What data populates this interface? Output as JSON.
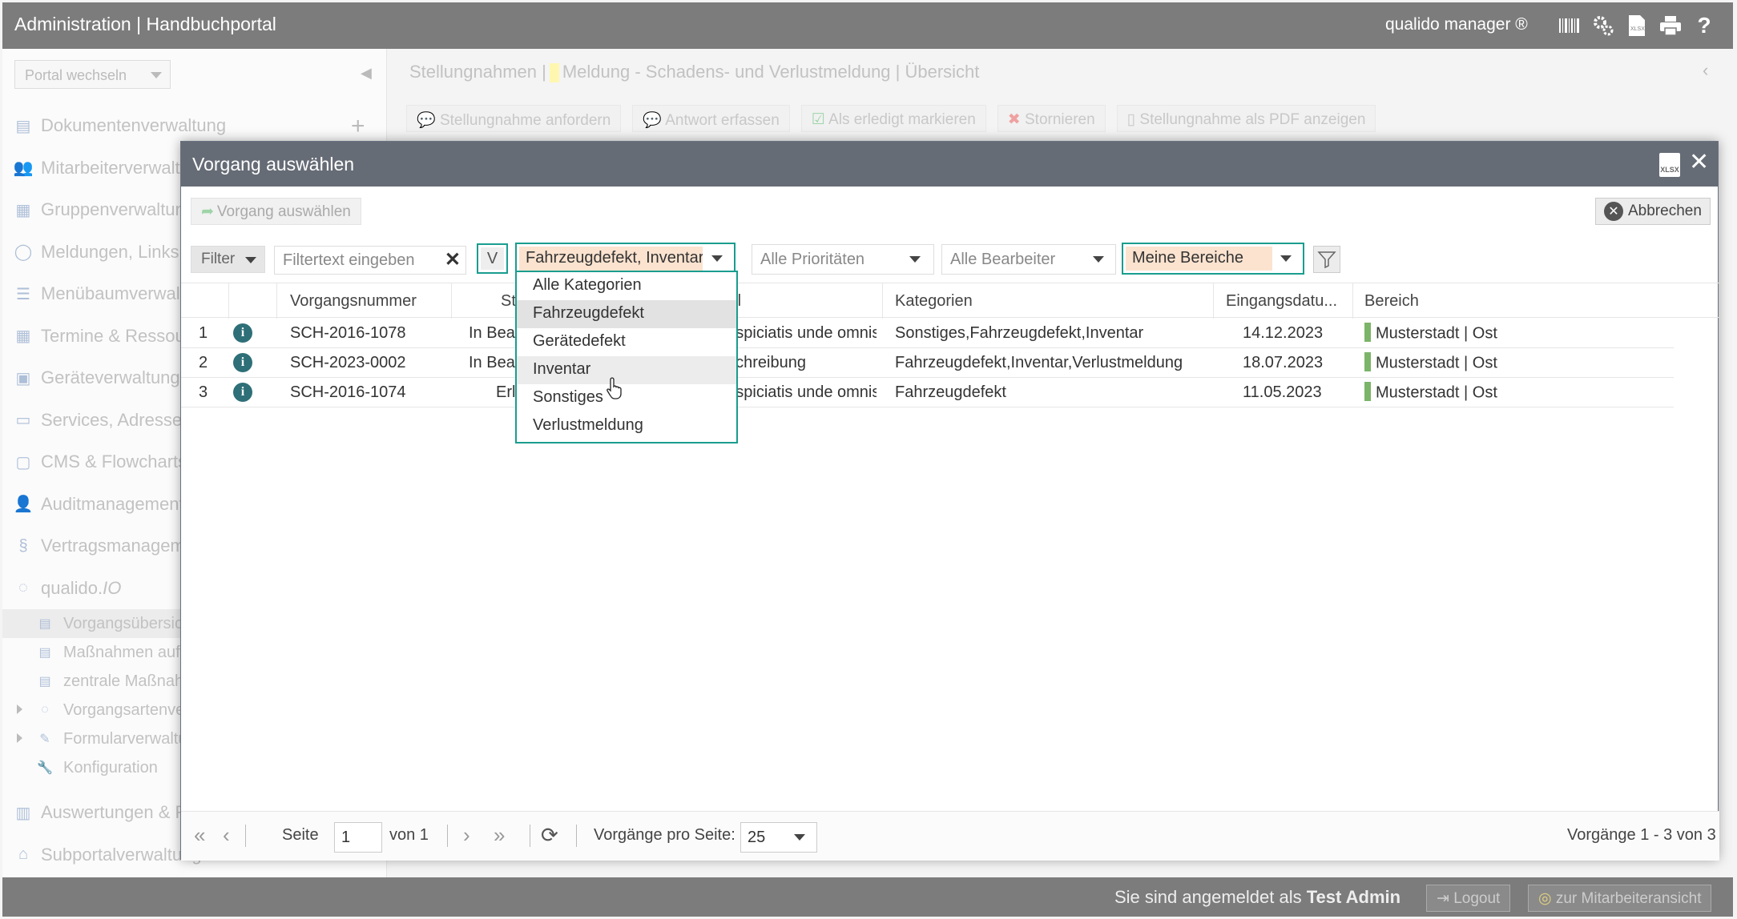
{
  "topbar": {
    "title": "Administration | Handbuchportal",
    "brand": "qualido manager ®",
    "icons": [
      "barcode-icon",
      "gears-icon",
      "xlsx-icon",
      "print-icon",
      "help-icon"
    ]
  },
  "sidebar": {
    "portal_select": "Portal wechseln",
    "items": [
      {
        "label": "Dokumentenverwaltung"
      },
      {
        "label": "Mitarbeiterverwaltung"
      },
      {
        "label": "Gruppenverwaltung"
      },
      {
        "label": "Meldungen, Links"
      },
      {
        "label": "Menübaumverwaltung"
      },
      {
        "label": "Termine & Ressourcen"
      },
      {
        "label": "Geräteverwaltung"
      },
      {
        "label": "Services, Adressen"
      },
      {
        "label": "CMS & Flowcharts"
      },
      {
        "label": "Auditmanagement"
      },
      {
        "label": "Vertragsmanagement"
      },
      {
        "label": "qualido.",
        "label_suffix": "IO"
      }
    ],
    "subitems": [
      {
        "label": "Vorgangsübersicht"
      },
      {
        "label": "Maßnahmen auf"
      },
      {
        "label": "zentrale Maßnahmen"
      },
      {
        "label": "Vorgangsartenverwaltung"
      },
      {
        "label": "Formularverwaltung"
      },
      {
        "label": "Konfiguration"
      }
    ],
    "bottom_items": [
      {
        "label": "Auswertungen & Reports"
      },
      {
        "label": "Subportalverwaltung"
      }
    ]
  },
  "main": {
    "breadcrumb_a": "Stellungnahmen |",
    "breadcrumb_b": "Meldung - Schadens- und Verlustmeldung | Übersicht",
    "toolbar": [
      "Stellungnahme anfordern",
      "Antwort erfassen",
      "Als erledigt markieren",
      "Stornieren",
      "Stellungnahme als PDF anzeigen"
    ]
  },
  "status": {
    "logged_prefix": "Sie sind angemeldet als",
    "user": "Test Admin",
    "logout": "Logout",
    "employee_view": "zur Mitarbeiteransicht"
  },
  "modal": {
    "title": "Vorgang auswählen",
    "select_button": "Vorgang auswählen",
    "cancel_button": "Abbrechen",
    "filter_label": "Filter",
    "filter_placeholder": "Filtertext eingeben",
    "v_button": "V",
    "category_value": "Fahrzeugdefekt, Inventar",
    "priority_value": "Alle Prioritäten",
    "assignee_value": "Alle Bearbeiter",
    "area_value": "Meine Bereiche",
    "columns": {
      "number": "Vorgangsnummer",
      "status": "Status",
      "title": "Titel",
      "categories": "Kategorien",
      "date": "Eingangsdatu...",
      "area": "Bereich"
    },
    "rows": [
      {
        "idx": "1",
        "number": "SCH-2016-1078",
        "status": "In Bearbeitung",
        "title": "Sed ut perspiciatis unde omnis ist...",
        "categories": "Sonstiges,Fahrzeugdefekt,Inventar",
        "date": "14.12.2023",
        "area": "Musterstadt | Ost"
      },
      {
        "idx": "2",
        "number": "SCH-2023-0002",
        "status": "In Bearbeitung",
        "title": "Testbeschreibung",
        "categories": "Fahrzeugdefekt,Inventar,Verlustmeldung",
        "date": "18.07.2023",
        "area": "Musterstadt | Ost"
      },
      {
        "idx": "3",
        "number": "SCH-2016-1074",
        "status": "Erledigt",
        "title": "Sed ut perspiciatis unde omnis ist...",
        "categories": "Fahrzeugdefekt",
        "date": "11.05.2023",
        "area": "Musterstadt | Ost"
      }
    ],
    "dropdown": [
      "Alle Kategorien",
      "Fahrzeugdefekt",
      "Gerätedefekt",
      "Inventar",
      "Sonstiges",
      "Verlustmeldung"
    ],
    "pager": {
      "page_label": "Seite",
      "page": "1",
      "of": "von 1",
      "per_page_label": "Vorgänge pro Seite:",
      "per_page": "25",
      "summary": "Vorgänge 1 - 3 von 3"
    }
  },
  "colors": {
    "accent": "#1a9d8f",
    "filter_highlight": "#fbe3cf",
    "area_bar": "#7cb46a",
    "info": "#2e6f78",
    "modal_header": "#666c76"
  }
}
